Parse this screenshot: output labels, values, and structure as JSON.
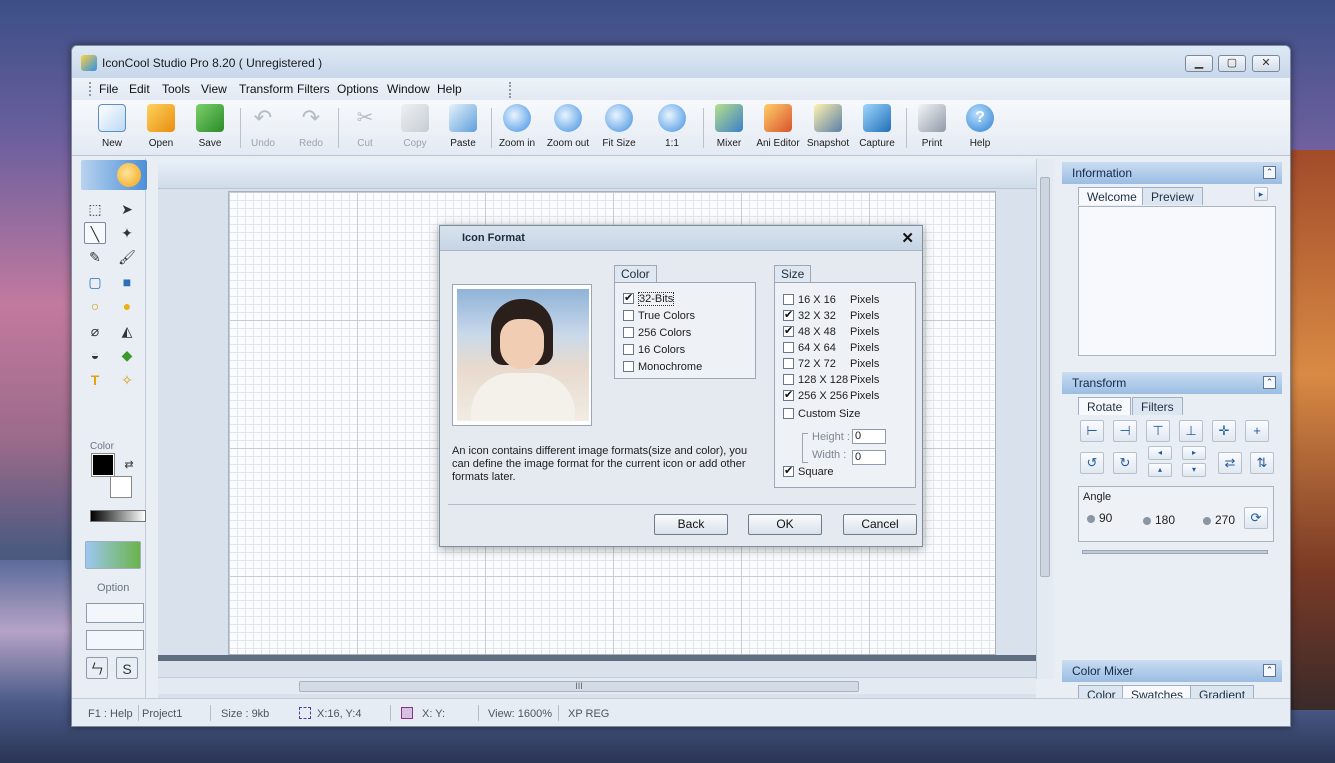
{
  "window": {
    "title": "IconCool Studio Pro 8.20 ( Unregistered )"
  },
  "menubar": {
    "items": [
      "File",
      "Edit",
      "Tools",
      "View",
      "Transform",
      "Filters",
      "Options",
      "Window",
      "Help"
    ]
  },
  "toolbar": {
    "buttons": [
      {
        "label": "New",
        "icon": "new-file-icon",
        "enabled": true
      },
      {
        "label": "Open",
        "icon": "open-folder-icon",
        "enabled": true
      },
      {
        "label": "Save",
        "icon": "save-disk-icon",
        "enabled": true
      },
      {
        "label": "Undo",
        "icon": "undo-arrow-icon",
        "enabled": false
      },
      {
        "label": "Redo",
        "icon": "redo-arrow-icon",
        "enabled": false
      },
      {
        "label": "Cut",
        "icon": "scissors-icon",
        "enabled": false
      },
      {
        "label": "Copy",
        "icon": "copy-pages-icon",
        "enabled": false
      },
      {
        "label": "Paste",
        "icon": "clipboard-icon",
        "enabled": true
      },
      {
        "label": "Zoom in",
        "icon": "zoom-in-icon",
        "enabled": true
      },
      {
        "label": "Zoom out",
        "icon": "zoom-out-icon",
        "enabled": true
      },
      {
        "label": "Fit Size",
        "icon": "fit-size-icon",
        "enabled": true
      },
      {
        "label": "1:1",
        "icon": "actual-size-icon",
        "enabled": true
      },
      {
        "label": "Mixer",
        "icon": "mixer-icon",
        "enabled": true
      },
      {
        "label": "Ani Editor",
        "icon": "animation-editor-icon",
        "enabled": true
      },
      {
        "label": "Snapshot",
        "icon": "camera-icon",
        "enabled": true
      },
      {
        "label": "Capture",
        "icon": "capture-icon",
        "enabled": true
      },
      {
        "label": "Print",
        "icon": "printer-icon",
        "enabled": true
      },
      {
        "label": "Help",
        "icon": "help-icon",
        "enabled": true
      }
    ]
  },
  "leftpanel": {
    "color_label": "Color",
    "option_label": "Option"
  },
  "rightpanel": {
    "information": {
      "title": "Information",
      "tabs": [
        "Welcome",
        "Preview"
      ]
    },
    "transform": {
      "title": "Transform",
      "tabs": [
        "Rotate",
        "Filters"
      ],
      "angle_label": "Angle",
      "angles": [
        "90",
        "180",
        "270"
      ]
    },
    "color_mixer": {
      "title": "Color Mixer",
      "tabs": [
        "Color",
        "Swatches",
        "Gradient"
      ]
    }
  },
  "statusbar": {
    "help": "F1 : Help",
    "project": "Project1",
    "size": "Size : 9kb",
    "cursor": "X:16, Y:4",
    "sel": "X: Y:",
    "view": "View: 1600%",
    "style": "XP REG"
  },
  "dialog": {
    "title": "Icon Format",
    "description": "An icon contains different image formats(size and color), you can define the image format for the current icon or add other formats later.",
    "color_group": {
      "title": "Color",
      "options": [
        {
          "label": "32-Bits",
          "checked": true
        },
        {
          "label": "True Colors",
          "checked": false
        },
        {
          "label": "256 Colors",
          "checked": false
        },
        {
          "label": "16 Colors",
          "checked": false
        },
        {
          "label": "Monochrome",
          "checked": false
        }
      ]
    },
    "size_group": {
      "title": "Size",
      "options": [
        {
          "label": "16 X 16",
          "unit": "Pixels",
          "checked": false
        },
        {
          "label": "32 X 32",
          "unit": "Pixels",
          "checked": true
        },
        {
          "label": "48 X 48",
          "unit": "Pixels",
          "checked": true
        },
        {
          "label": "64 X 64",
          "unit": "Pixels",
          "checked": false
        },
        {
          "label": "72 X 72",
          "unit": "Pixels",
          "checked": false
        },
        {
          "label": "128 X 128",
          "unit": "Pixels",
          "checked": false
        },
        {
          "label": "256 X 256",
          "unit": "Pixels",
          "checked": true
        }
      ],
      "custom_label": "Custom Size",
      "height_label": "Height :",
      "height_value": "0",
      "width_label": "Width :",
      "width_value": "0",
      "square_label": "Square",
      "square_checked": true
    },
    "buttons": {
      "back": "Back",
      "ok": "OK",
      "cancel": "Cancel"
    }
  },
  "colors": {
    "accent": "#4c8fd8",
    "panel": "#e9eef4",
    "dialog": "#e5eaf0"
  }
}
